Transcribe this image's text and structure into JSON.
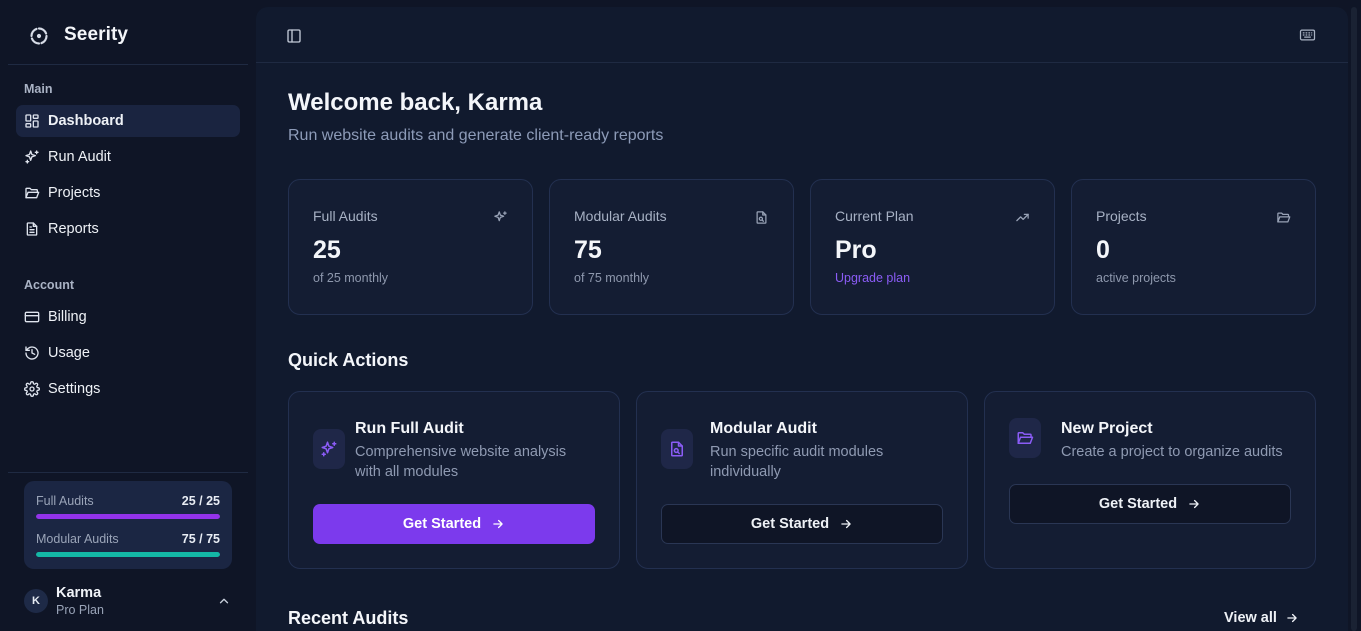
{
  "app": {
    "name": "Seerity",
    "logo_icon": "seerity-logo-icon"
  },
  "sidebar": {
    "main_label": "Main",
    "main_items": [
      {
        "label": "Dashboard",
        "icon": "layout-dashboard-icon",
        "active": true
      },
      {
        "label": "Run Audit",
        "icon": "sparkles-icon"
      },
      {
        "label": "Projects",
        "icon": "folder-icon"
      },
      {
        "label": "Reports",
        "icon": "file-text-icon"
      }
    ],
    "account_label": "Account",
    "account_items": [
      {
        "label": "Billing",
        "icon": "credit-card-icon"
      },
      {
        "label": "Usage",
        "icon": "history-icon"
      },
      {
        "label": "Settings",
        "icon": "gear-icon"
      }
    ],
    "usage": [
      {
        "label": "Full Audits",
        "value": "25 / 25",
        "fraction": 1.0,
        "color": "#9333ea"
      },
      {
        "label": "Modular Audits",
        "value": "75 / 75",
        "fraction": 1.0,
        "color": "#14b8a6"
      }
    ],
    "user": {
      "initial": "K",
      "name": "Karma",
      "plan": "Pro Plan"
    }
  },
  "header": {
    "sidebar_toggle_icon": "panel-left-icon",
    "keyboard_icon": "keyboard-icon"
  },
  "main": {
    "welcome": "Welcome back, Karma",
    "subtitle": "Run website audits and generate client-ready reports",
    "stats": [
      {
        "label": "Full Audits",
        "value": "25",
        "note": "of 25 monthly",
        "icon": "sparkles-icon"
      },
      {
        "label": "Modular Audits",
        "value": "75",
        "note": "of 75 monthly",
        "icon": "file-search-icon"
      },
      {
        "label": "Current Plan",
        "value": "Pro",
        "note": "Upgrade plan",
        "icon": "trending-up-icon"
      },
      {
        "label": "Projects",
        "value": "0",
        "note": "active projects",
        "icon": "folder-open-icon"
      }
    ],
    "quick_actions_title": "Quick Actions",
    "quick_actions": [
      {
        "title": "Run Full Audit",
        "description": "Comprehensive website analysis with all modules",
        "button": "Get Started",
        "icon": "sparkles-icon"
      },
      {
        "title": "Modular Audit",
        "description": "Run specific audit modules individually",
        "button": "Get Started",
        "icon": "file-search-icon"
      },
      {
        "title": "New Project",
        "description": "Create a project to organize audits",
        "button": "Get Started",
        "icon": "folder-open-icon"
      }
    ],
    "recent_title": "Recent Audits",
    "view_all": "View all"
  },
  "colors": {
    "accent": "#7c3aed",
    "teal": "#14b8a6",
    "background": "#0f1526"
  }
}
